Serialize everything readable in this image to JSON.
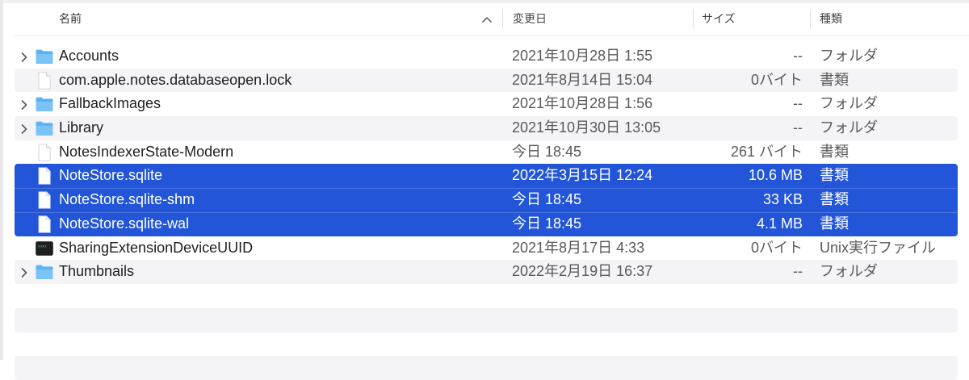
{
  "header": {
    "name_label": "名前",
    "date_label": "変更日",
    "size_label": "サイズ",
    "kind_label": "種類",
    "sort_direction": "ascending"
  },
  "rows": [
    {
      "name": "Accounts",
      "date": "2021年10月28日 1:55",
      "size": "--",
      "kind": "フォルダ",
      "icon": "folder-icon",
      "expandable": true,
      "selected": false
    },
    {
      "name": "com.apple.notes.databaseopen.lock",
      "date": "2021年8月14日 15:04",
      "size": "0バイト",
      "kind": "書類",
      "icon": "document-icon",
      "expandable": false,
      "selected": false
    },
    {
      "name": "FallbackImages",
      "date": "2021年10月28日 1:56",
      "size": "--",
      "kind": "フォルダ",
      "icon": "folder-icon",
      "expandable": true,
      "selected": false
    },
    {
      "name": "Library",
      "date": "2021年10月30日 13:05",
      "size": "--",
      "kind": "フォルダ",
      "icon": "folder-icon",
      "expandable": true,
      "selected": false
    },
    {
      "name": "NotesIndexerState-Modern",
      "date": "今日 18:45",
      "size": "261 バイト",
      "kind": "書類",
      "icon": "document-icon",
      "expandable": false,
      "selected": false
    },
    {
      "name": "NoteStore.sqlite",
      "date": "2022年3月15日 12:24",
      "size": "10.6 MB",
      "kind": "書類",
      "icon": "document-icon",
      "expandable": false,
      "selected": true
    },
    {
      "name": "NoteStore.sqlite-shm",
      "date": "今日 18:45",
      "size": "33 KB",
      "kind": "書類",
      "icon": "document-icon",
      "expandable": false,
      "selected": true
    },
    {
      "name": "NoteStore.sqlite-wal",
      "date": "今日 18:45",
      "size": "4.1 MB",
      "kind": "書類",
      "icon": "document-icon",
      "expandable": false,
      "selected": true
    },
    {
      "name": "SharingExtensionDeviceUUID",
      "date": "2021年8月17日 4:33",
      "size": "0バイト",
      "kind": "Unix実行ファイル",
      "icon": "terminal-executable-icon",
      "expandable": false,
      "selected": false
    },
    {
      "name": "Thumbnails",
      "date": "2022年2月19日 16:37",
      "size": "--",
      "kind": "フォルダ",
      "icon": "folder-icon",
      "expandable": true,
      "selected": false
    }
  ],
  "colors": {
    "selection": "#2255d7",
    "folder_blue": "#5fb4f2",
    "alt_row": "#f4f4f6"
  }
}
